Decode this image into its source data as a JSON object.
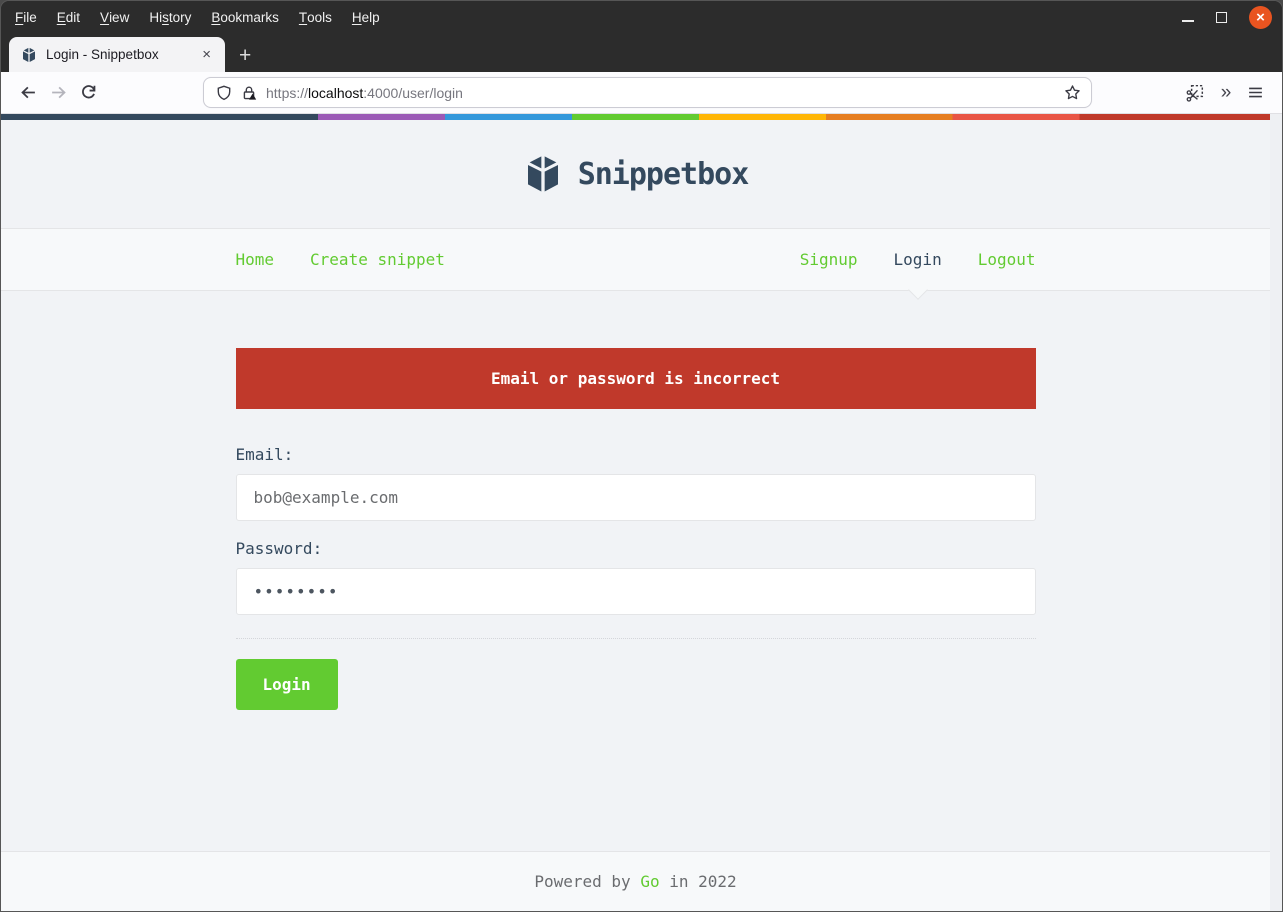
{
  "theme": {
    "accent_green": "#62cb31",
    "error_red": "#c0392b",
    "text_dark": "#34495e",
    "text_gray": "#6a6c6f",
    "body_bg": "#f1f3f6",
    "nav_footer_bg": "#f7f9fa",
    "border": "#e4e5e7",
    "chrome_dark": "#2c2c2c",
    "close_button_orange": "#e95420",
    "rainbow_stripe": [
      "#34495e",
      "#9b59b6",
      "#3498db",
      "#62cb31",
      "#ffb606",
      "#e67e22",
      "#e95546",
      "#c0392b"
    ]
  },
  "menubar": {
    "items": [
      {
        "label": "File",
        "pre": "",
        "key": "F",
        "post": "ile"
      },
      {
        "label": "Edit",
        "pre": "",
        "key": "E",
        "post": "dit"
      },
      {
        "label": "View",
        "pre": "",
        "key": "V",
        "post": "iew"
      },
      {
        "label": "History",
        "pre": "Hi",
        "key": "s",
        "post": "tory"
      },
      {
        "label": "Bookmarks",
        "pre": "",
        "key": "B",
        "post": "ookmarks"
      },
      {
        "label": "Tools",
        "pre": "",
        "key": "T",
        "post": "ools"
      },
      {
        "label": "Help",
        "pre": "",
        "key": "H",
        "post": "elp"
      }
    ]
  },
  "window_controls": {
    "close_glyph": "×"
  },
  "tabbar": {
    "active_tab_title": "Login - Snippetbox",
    "tab_close_glyph": "×",
    "new_tab_glyph": "+"
  },
  "toolbar": {
    "url": {
      "protocol": "https://",
      "host": "localhost",
      "port_path": ":4000/user/login"
    },
    "overflow_chevrons": "»"
  },
  "site": {
    "title": "Snippetbox",
    "nav": {
      "left": [
        {
          "label": "Home"
        },
        {
          "label": "Create snippet"
        }
      ],
      "right": [
        {
          "label": "Signup"
        },
        {
          "label": "Login"
        },
        {
          "label": "Logout"
        }
      ]
    },
    "flash_error": "Email or password is incorrect",
    "form": {
      "email_label": "Email:",
      "email_value": "bob@example.com",
      "password_label": "Password:",
      "password_value": "••••••••",
      "submit_label": "Login"
    },
    "footer": {
      "pre": "Powered by ",
      "link": "Go",
      "post": " in 2022"
    }
  }
}
